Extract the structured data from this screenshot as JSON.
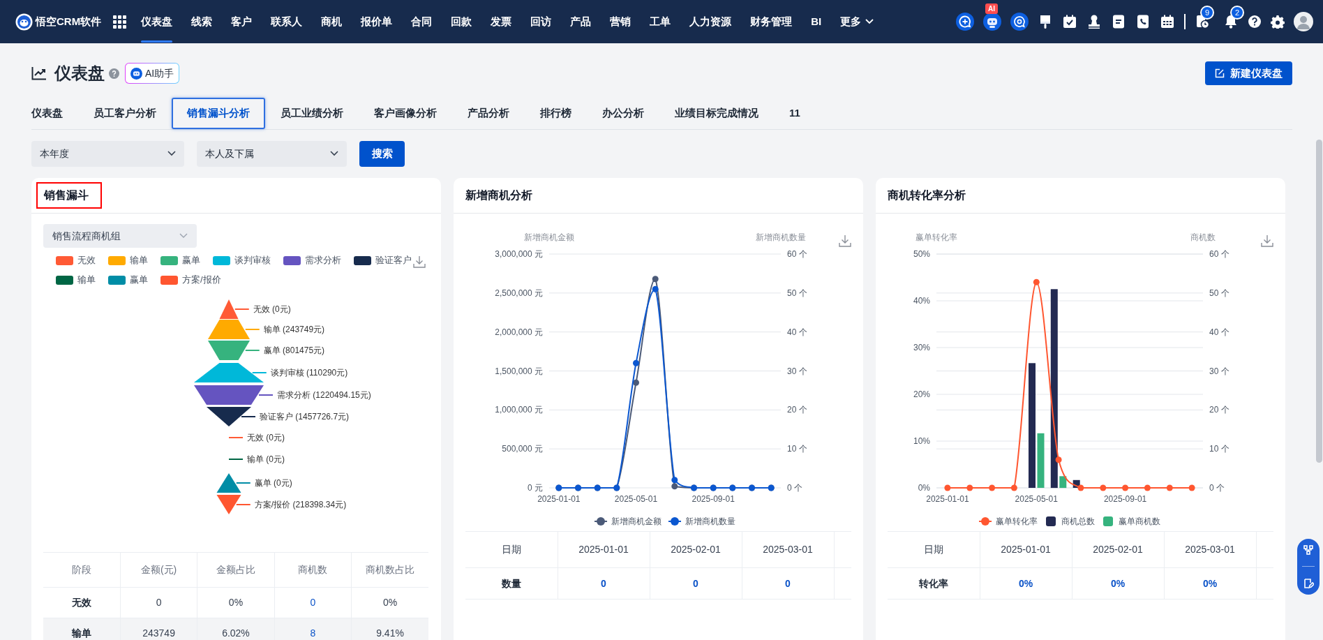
{
  "nav": {
    "logo": "悟空CRM软件",
    "items": [
      {
        "label": "仪表盘",
        "selected": true
      },
      {
        "label": "线索",
        "selected": false
      },
      {
        "label": "客户",
        "selected": false
      },
      {
        "label": "联系人",
        "selected": false
      },
      {
        "label": "商机",
        "selected": false
      },
      {
        "label": "报价单",
        "selected": false
      },
      {
        "label": "合同",
        "selected": false
      },
      {
        "label": "回款",
        "selected": false
      },
      {
        "label": "发票",
        "selected": false
      },
      {
        "label": "回访",
        "selected": false
      },
      {
        "label": "产品",
        "selected": false
      },
      {
        "label": "营销",
        "selected": false
      },
      {
        "label": "工单",
        "selected": false
      },
      {
        "label": "人力资源",
        "selected": false
      },
      {
        "label": "财务管理",
        "selected": false
      },
      {
        "label": "BI",
        "selected": false
      }
    ],
    "more": "更多",
    "robot_badge": "AI",
    "task_badge": "9",
    "bell_badge": "2"
  },
  "page": {
    "title": "仪表盘",
    "ai_button": "AI助手",
    "new_button": "新建仪表盘"
  },
  "tabs": [
    {
      "label": "仪表盘",
      "selected": false
    },
    {
      "label": "员工客户分析",
      "selected": false
    },
    {
      "label": "销售漏斗分析",
      "selected": true
    },
    {
      "label": "员工业绩分析",
      "selected": false
    },
    {
      "label": "客户画像分析",
      "selected": false
    },
    {
      "label": "产品分析",
      "selected": false
    },
    {
      "label": "排行榜",
      "selected": false
    },
    {
      "label": "办公分析",
      "selected": false
    },
    {
      "label": "业绩目标完成情况",
      "selected": false
    },
    {
      "label": "11",
      "selected": false
    }
  ],
  "filters": {
    "period": "本年度",
    "scope": "本人及下属",
    "search_button": "搜索"
  },
  "funnel_card": {
    "title": "销售漏斗",
    "highlighted": true,
    "group_select": "销售流程商机组",
    "legend": [
      {
        "label": "无效",
        "color": "#ff5a35"
      },
      {
        "label": "输单",
        "color": "#ffaa00"
      },
      {
        "label": "赢单",
        "color": "#36b37e"
      },
      {
        "label": "谈判审核",
        "color": "#00b8d9"
      },
      {
        "label": "需求分析",
        "color": "#6554c0"
      },
      {
        "label": "验证客户",
        "color": "#172b4d"
      },
      {
        "label": "输单",
        "color": "#006644"
      },
      {
        "label": "赢单",
        "color": "#008da6"
      },
      {
        "label": "方案/报价",
        "color": "#ff5630"
      }
    ],
    "segments": [
      {
        "kind": "shape",
        "label": "无效 (0元)",
        "color": "#ff5a35"
      },
      {
        "kind": "shape",
        "label": "输单 (243749元)",
        "color": "#ffaa00"
      },
      {
        "kind": "shape",
        "label": "赢单 (801475元)",
        "color": "#36b37e"
      },
      {
        "kind": "shape",
        "label": "谈判审核 (110290元)",
        "color": "#00b8d9"
      },
      {
        "kind": "shape",
        "label": "需求分析 (1220494.15元)",
        "color": "#6554c0"
      },
      {
        "kind": "shape",
        "label": "验证客户 (1457726.7元)",
        "color": "#172b4d"
      },
      {
        "kind": "label",
        "label": "无效 (0元)",
        "color": "#ff5a35"
      },
      {
        "kind": "label",
        "label": "输单 (0元)",
        "color": "#006644"
      },
      {
        "kind": "shape",
        "label": "赢单 (0元)",
        "color": "#008da6"
      },
      {
        "kind": "shape",
        "label": "方案/报价 (218398.34元)",
        "color": "#ff5630"
      }
    ],
    "table": {
      "columns": [
        {
          "label": "阶段",
          "link": false
        },
        {
          "label": "金额(元)",
          "link": false
        },
        {
          "label": "金额占比",
          "link": false
        },
        {
          "label": "商机数",
          "link": true
        },
        {
          "label": "商机数占比",
          "link": false
        }
      ],
      "rows": [
        [
          "无效",
          "0",
          "0%",
          "0",
          "0%"
        ],
        [
          "输单",
          "243749",
          "6.02%",
          "8",
          "9.41%"
        ]
      ]
    }
  },
  "new_opportunity_card": {
    "title": "新增商机分析",
    "chart_data": {
      "type": "line",
      "grid": true,
      "legend": "bottom",
      "ylabel": "新增商机金额",
      "y2label": "新增商机数量",
      "categories": [
        "2025-01-01",
        null,
        null,
        null,
        "2025-05-01",
        null,
        null,
        null,
        "2025-09-01",
        null,
        null,
        null
      ],
      "ylim": [
        0,
        3000000
      ],
      "yticks": [
        {
          "value": 0,
          "label": "0 元"
        },
        {
          "value": 500000,
          "label": "500,000 元"
        },
        {
          "value": 1000000,
          "label": "1,000,000 元"
        },
        {
          "value": 1500000,
          "label": "1,500,000 元"
        },
        {
          "value": 2000000,
          "label": "2,000,000 元"
        },
        {
          "value": 2500000,
          "label": "2,500,000 元"
        },
        {
          "value": 3000000,
          "label": "3,000,000 元"
        }
      ],
      "y2lim": [
        0,
        60
      ],
      "y2ticks": [
        {
          "value": 0,
          "label": "0 个"
        },
        {
          "value": 10,
          "label": "10 个"
        },
        {
          "value": 20,
          "label": "20 个"
        },
        {
          "value": 30,
          "label": "30 个"
        },
        {
          "value": 40,
          "label": "40 个"
        },
        {
          "value": 50,
          "label": "50 个"
        },
        {
          "value": 60,
          "label": "60 个"
        }
      ],
      "series": [
        {
          "name": "新增商机金额",
          "type": "line",
          "marker": true,
          "color": "#4b5a78",
          "values": [
            0,
            0,
            0,
            0,
            1350000,
            2680000,
            20000,
            0,
            0,
            0,
            0,
            0
          ]
        },
        {
          "name": "新增商机数量",
          "type": "line",
          "marker": true,
          "axis": "y2",
          "color": "#0b57d0",
          "values": [
            0,
            0,
            0,
            0,
            32,
            51,
            2,
            0,
            0,
            0,
            0,
            0
          ]
        }
      ]
    },
    "table": {
      "columns": [
        "日期",
        "2025-01-01",
        "2025-02-01",
        "2025-03-01"
      ],
      "rows": [
        [
          "数量",
          "0",
          "0",
          "0"
        ]
      ]
    }
  },
  "conversion_card": {
    "title": "商机转化率分析",
    "chart_data": {
      "type": "bar",
      "grid": true,
      "legend": "bottom",
      "ylabel": "赢单转化率",
      "y2label": "商机数",
      "categories": [
        "2025-01-01",
        null,
        null,
        null,
        "2025-05-01",
        null,
        null,
        null,
        "2025-09-01",
        null,
        null,
        null
      ],
      "ylim": [
        0,
        50
      ],
      "yticks": [
        {
          "value": 0,
          "label": "0%"
        },
        {
          "value": 10,
          "label": "10%"
        },
        {
          "value": 20,
          "label": "20%"
        },
        {
          "value": 30,
          "label": "30%"
        },
        {
          "value": 40,
          "label": "40%"
        },
        {
          "value": 50,
          "label": "50%"
        }
      ],
      "y2lim": [
        0,
        60
      ],
      "y2ticks": [
        {
          "value": 0,
          "label": "0 个"
        },
        {
          "value": 10,
          "label": "10 个"
        },
        {
          "value": 20,
          "label": "20 个"
        },
        {
          "value": 30,
          "label": "30 个"
        },
        {
          "value": 40,
          "label": "40 个"
        },
        {
          "value": 50,
          "label": "50 个"
        },
        {
          "value": 60,
          "label": "60 个"
        }
      ],
      "series": [
        {
          "name": "赢单转化率",
          "type": "line",
          "marker": true,
          "color": "#ff5630",
          "values": [
            0,
            0,
            0,
            0,
            44,
            6,
            0,
            0,
            0,
            0,
            0,
            0
          ]
        },
        {
          "name": "商机总数",
          "type": "bar",
          "axis": "y2",
          "color": "#232a52",
          "values": [
            0,
            0,
            0,
            0,
            32,
            51,
            2,
            0,
            0,
            0,
            0,
            0
          ]
        },
        {
          "name": "赢单商机数",
          "type": "bar",
          "axis": "y2",
          "color": "#36b37e",
          "values": [
            0,
            0,
            0,
            0,
            14,
            3,
            0,
            0,
            0,
            0,
            0,
            0
          ]
        }
      ]
    },
    "table": {
      "columns": [
        "日期",
        "2025-01-01",
        "2025-02-01",
        "2025-03-01"
      ],
      "rows": [
        [
          "转化率",
          "0%",
          "0%",
          "0%"
        ]
      ]
    }
  }
}
